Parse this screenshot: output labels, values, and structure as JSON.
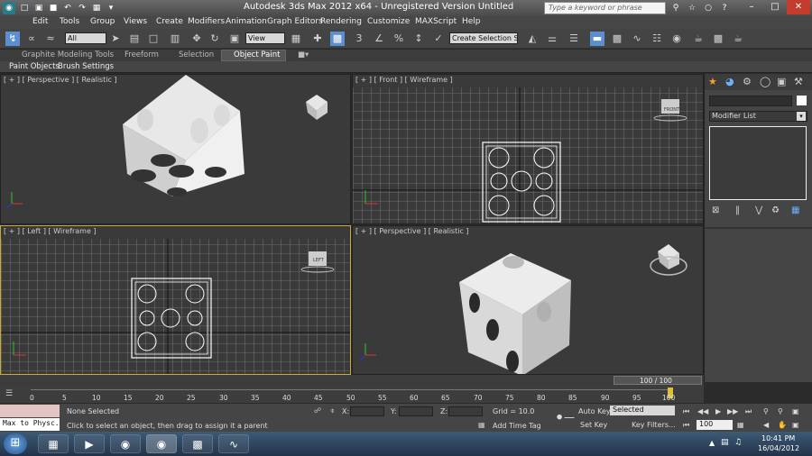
{
  "window": {
    "title": "Autodesk 3ds Max  2012 x64  -  Unregistered Version   Untitled",
    "search_placeholder": "Type a keyword or phrase"
  },
  "menus": [
    "Edit",
    "Tools",
    "Group",
    "Views",
    "Create",
    "Modifiers",
    "Animation",
    "Graph Editors",
    "Rendering",
    "Customize",
    "MAXScript",
    "Help"
  ],
  "toolbar": {
    "selection_filter": "All",
    "ref_coord": "View",
    "named_selection": "Create Selection Se"
  },
  "ribbon": {
    "tabs": [
      "Graphite Modeling Tools",
      "Freeform",
      "Selection",
      "Object Paint"
    ],
    "subtabs": [
      "Paint Objects",
      "Brush Settings"
    ]
  },
  "viewports": {
    "top_left": "[ + ] [ Perspective ] [ Realistic ]",
    "top_right": "[ + ] [ Front ] [ Wireframe ]",
    "bottom_left": "[ + ] [ Left ] [ Wireframe ]",
    "bottom_right": "[ + ] [ Perspective ] [ Realistic ]",
    "cube_front": "FRONT",
    "cube_left": "LEFT"
  },
  "command_panel": {
    "modifier_list": "Modifier List"
  },
  "timeline": {
    "frame": "100 / 100",
    "ticks": [
      "0",
      "5",
      "10",
      "15",
      "20",
      "25",
      "30",
      "35",
      "40",
      "45",
      "50",
      "55",
      "60",
      "65",
      "70",
      "75",
      "80",
      "85",
      "90",
      "95",
      "100"
    ]
  },
  "status": {
    "max_to_physc": "Max to Physc.",
    "selected": "None Selected",
    "prompt": "Click to select an object, then drag to assign it a parent",
    "x_label": "X:",
    "y_label": "Y:",
    "z_label": "Z:",
    "grid": "Grid = 10.0",
    "add_time_tag": "Add Time Tag",
    "auto_key": "Auto Key",
    "set_key": "Set Key",
    "key_mode": "Selected",
    "key_filters": "Key Filters...",
    "frame_field": "100"
  },
  "taskbar": {
    "time": "10:41 PM",
    "date": "16/04/2012"
  }
}
